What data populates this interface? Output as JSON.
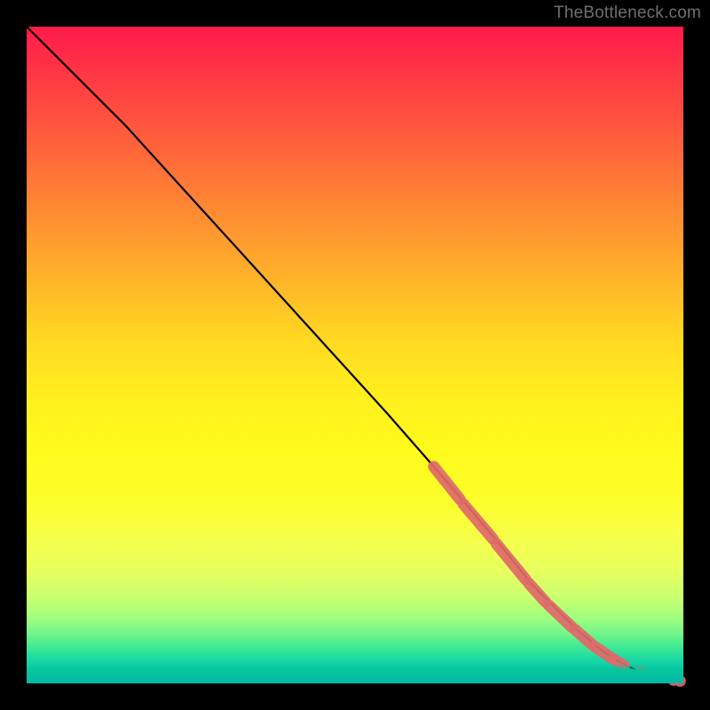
{
  "watermark": "TheBottleneck.com",
  "chart_data": {
    "type": "line",
    "title": "",
    "xlabel": "",
    "ylabel": "",
    "xlim": [
      0,
      100
    ],
    "ylim": [
      0,
      100
    ],
    "grid": false,
    "legend": false,
    "series": [
      {
        "name": "curve",
        "color": "#000000",
        "x": [
          0,
          3,
          8,
          15,
          25,
          35,
          45,
          55,
          62,
          68,
          73,
          77,
          81,
          84,
          87,
          89.5,
          92,
          94,
          96,
          98,
          100
        ],
        "y": [
          100,
          97,
          92,
          85,
          74,
          63,
          52,
          41,
          33,
          26,
          20,
          15,
          11,
          8,
          5.5,
          3.7,
          2.4,
          1.5,
          0.9,
          0.5,
          0.3
        ]
      }
    ],
    "markers": [
      {
        "name": "highlight-segments",
        "color": "#e06a6a",
        "type": "thick-overlay",
        "segments": [
          {
            "x": [
              62,
              66
            ],
            "y": [
              33,
              28
            ]
          },
          {
            "x": [
              66.5,
              71
            ],
            "y": [
              27.3,
              22
            ]
          },
          {
            "x": [
              71.5,
              76
            ],
            "y": [
              21.3,
              15.8
            ]
          },
          {
            "x": [
              76.5,
              79
            ],
            "y": [
              15.2,
              12.4
            ]
          },
          {
            "x": [
              79.5,
              83
            ],
            "y": [
              11.9,
              8.6
            ]
          },
          {
            "x": [
              83.5,
              86
            ],
            "y": [
              8.2,
              6.0
            ]
          },
          {
            "x": [
              86.5,
              89
            ],
            "y": [
              5.6,
              3.9
            ]
          },
          {
            "x": [
              89.5,
              91
            ],
            "y": [
              3.6,
              2.7
            ]
          }
        ]
      },
      {
        "name": "highlight-dots",
        "color": "#e06a6a",
        "type": "dot",
        "points": [
          {
            "x": 93.5,
            "y": 1.7
          },
          {
            "x": 95.0,
            "y": 1.2
          },
          {
            "x": 98.5,
            "y": 0.5
          },
          {
            "x": 99.5,
            "y": 0.35
          }
        ]
      }
    ]
  }
}
